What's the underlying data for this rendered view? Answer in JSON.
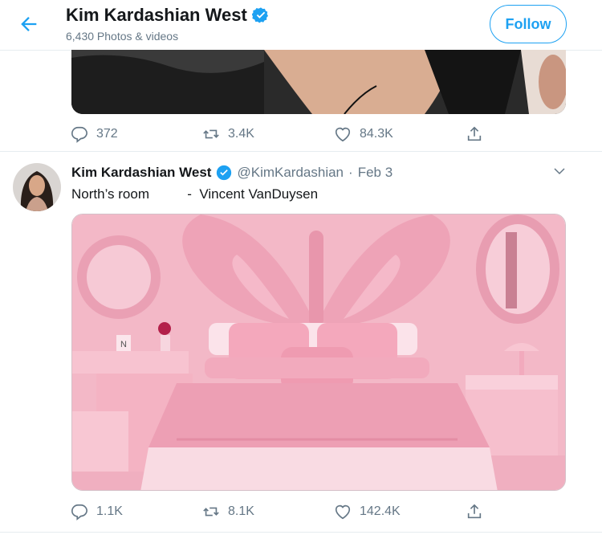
{
  "header": {
    "name": "Kim Kardashian West",
    "subtitle": "6,430 Photos & videos",
    "follow_label": "Follow"
  },
  "tweet1": {
    "replies": "372",
    "retweets": "3.4K",
    "likes": "84.3K"
  },
  "tweet2": {
    "name": "Kim Kardashian West",
    "handle": "@KimKardashian",
    "dot": "·",
    "date": "Feb 3",
    "text": "North’s room          -  Vincent VanDuysen",
    "replies": "1.1K",
    "retweets": "8.1K",
    "likes": "142.4K"
  },
  "icons": {
    "back": "arrow-left-icon",
    "verified": "verified-badge-icon",
    "reply": "reply-icon",
    "retweet": "retweet-icon",
    "like": "heart-icon",
    "share": "share-icon",
    "more": "chevron-down-icon"
  },
  "colors": {
    "accent": "#1da1f2",
    "muted": "#657786",
    "room_pink": "#f2a9bd"
  }
}
